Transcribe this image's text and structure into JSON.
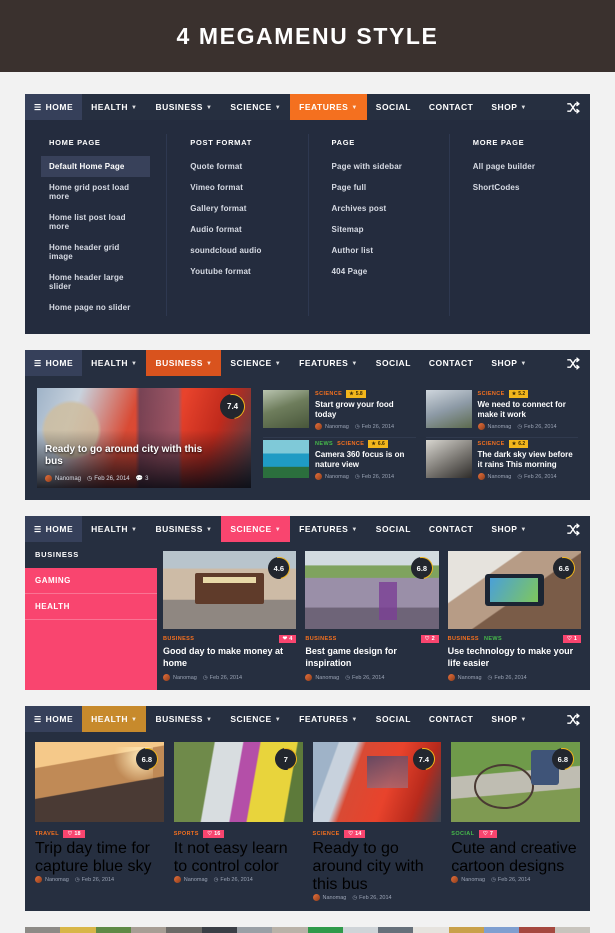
{
  "banner": {
    "title": "4 MEGAMENU STYLE"
  },
  "nav": {
    "home_label": "HOME",
    "items": [
      {
        "label": "HEALTH",
        "caret": true
      },
      {
        "label": "BUSINESS",
        "caret": true
      },
      {
        "label": "SCIENCE",
        "caret": true
      },
      {
        "label": "FEATURES",
        "caret": true
      },
      {
        "label": "SOCIAL",
        "caret": false
      },
      {
        "label": "CONTACT",
        "caret": false
      },
      {
        "label": "SHOP",
        "caret": true
      }
    ],
    "shuffle_icon": "shuffle-icon"
  },
  "colors": {
    "features_active": "#f4701f",
    "business_active": "#d9531e",
    "science_active": "#f9456f",
    "health_active": "#c78a2c",
    "panel_bg": "#262f40",
    "megamenu_bg": "#242c3e",
    "banner_bg": "#3a312e",
    "tag_orange": "#f4701f",
    "tag_green": "#46b94a",
    "rating_ring": "#f2b61c",
    "heart_badge": "#f9456f"
  },
  "megamenu": {
    "columns": [
      {
        "title": "HOME PAGE",
        "links": [
          {
            "label": "Default Home Page",
            "active": true
          },
          {
            "label": "Home grid post load more",
            "active": false
          },
          {
            "label": "Home list post load more",
            "active": false
          },
          {
            "label": "Home header grid image",
            "active": false
          },
          {
            "label": "Home header large slider",
            "active": false
          },
          {
            "label": "Home page no slider",
            "active": false
          }
        ]
      },
      {
        "title": "POST FORMAT",
        "links": [
          {
            "label": "Quote format",
            "active": false
          },
          {
            "label": "Vimeo format",
            "active": false
          },
          {
            "label": "Gallery format",
            "active": false
          },
          {
            "label": "Audio format",
            "active": false
          },
          {
            "label": "soundcloud audio",
            "active": false
          },
          {
            "label": "Youtube format",
            "active": false
          }
        ]
      },
      {
        "title": "PAGE",
        "links": [
          {
            "label": "Page with sidebar",
            "active": false
          },
          {
            "label": "Page full",
            "active": false
          },
          {
            "label": "Archives post",
            "active": false
          },
          {
            "label": "Sitemap",
            "active": false
          },
          {
            "label": "Author list",
            "active": false
          },
          {
            "label": "404 Page",
            "active": false
          }
        ]
      },
      {
        "title": "MORE PAGE",
        "links": [
          {
            "label": "All page builder",
            "active": false
          },
          {
            "label": "ShortCodes",
            "active": false
          }
        ]
      }
    ]
  },
  "business_panel": {
    "featured": {
      "title": "Ready to go around city with this bus",
      "author": "Nanomag",
      "date": "Feb 26, 2014",
      "comments": "3",
      "rating": "7.4"
    },
    "posts": [
      {
        "tags": [
          {
            "text": "SCIENCE",
            "color": "orange"
          }
        ],
        "star": "5.8",
        "title": "Start grow your food today",
        "author": "Nanomag",
        "date": "Feb 26, 2014"
      },
      {
        "tags": [
          {
            "text": "SCIENCE",
            "color": "orange"
          }
        ],
        "star": "5.2",
        "title": "We need to connect for make it work",
        "author": "Nanomag",
        "date": "Feb 26, 2014"
      },
      {
        "tags": [
          {
            "text": "NEWS",
            "color": "green"
          },
          {
            "text": "SCIENCE",
            "color": "orange"
          }
        ],
        "star": "6.6",
        "title": "Camera 360 focus is on nature view",
        "author": "Nanomag",
        "date": "Feb 26, 2014"
      },
      {
        "tags": [
          {
            "text": "SCIENCE",
            "color": "orange"
          }
        ],
        "star": "6.2",
        "title": "The dark sky view before it rains This morning",
        "author": "Nanomag",
        "date": "Feb 26, 2014"
      }
    ]
  },
  "science_panel": {
    "sidebar": {
      "heading": "BUSINESS",
      "items": [
        {
          "label": "GAMING"
        },
        {
          "label": "HEALTH"
        }
      ]
    },
    "cards": [
      {
        "tags": [
          {
            "text": "BUSINESS",
            "color": "orange"
          }
        ],
        "likes": "4",
        "rating": "4.6",
        "title": "Good day to make money at home",
        "author": "Nanomag",
        "date": "Feb 26, 2014"
      },
      {
        "tags": [
          {
            "text": "BUSINESS",
            "color": "orange"
          }
        ],
        "likes": "2",
        "rating": "6.8",
        "title": "Best game design for inspiration",
        "author": "Nanomag",
        "date": "Feb 26, 2014"
      },
      {
        "tags": [
          {
            "text": "BUSINESS",
            "color": "orange"
          },
          {
            "text": "NEWS",
            "color": "green"
          }
        ],
        "likes": "1",
        "rating": "6.6",
        "title": "Use technology to make your life easier",
        "author": "Nanomag",
        "date": "Feb 26, 2014"
      }
    ]
  },
  "health_panel": {
    "cards": [
      {
        "tags": [
          {
            "text": "TRAVEL",
            "color": "orange"
          }
        ],
        "likes": "18",
        "rating": "6.8",
        "title": "Trip day time for capture blue sky",
        "author": "Nanomag",
        "date": "Feb 26, 2014"
      },
      {
        "tags": [
          {
            "text": "SPORTS",
            "color": "orange"
          }
        ],
        "likes": "16",
        "rating": "7",
        "title": "It not easy learn to control color",
        "author": "Nanomag",
        "date": "Feb 26, 2014"
      },
      {
        "tags": [
          {
            "text": "SCIENCE",
            "color": "orange"
          }
        ],
        "likes": "14",
        "rating": "7.4",
        "title": "Ready to go around city with this bus",
        "author": "Nanomag",
        "date": "Feb 26, 2014"
      },
      {
        "tags": [
          {
            "text": "SOCIAL",
            "color": "green"
          }
        ],
        "likes": "7",
        "rating": "6.8",
        "title": "Cute and creative cartoon designs",
        "author": "Nanomag",
        "date": "Feb 26, 2014"
      }
    ]
  }
}
